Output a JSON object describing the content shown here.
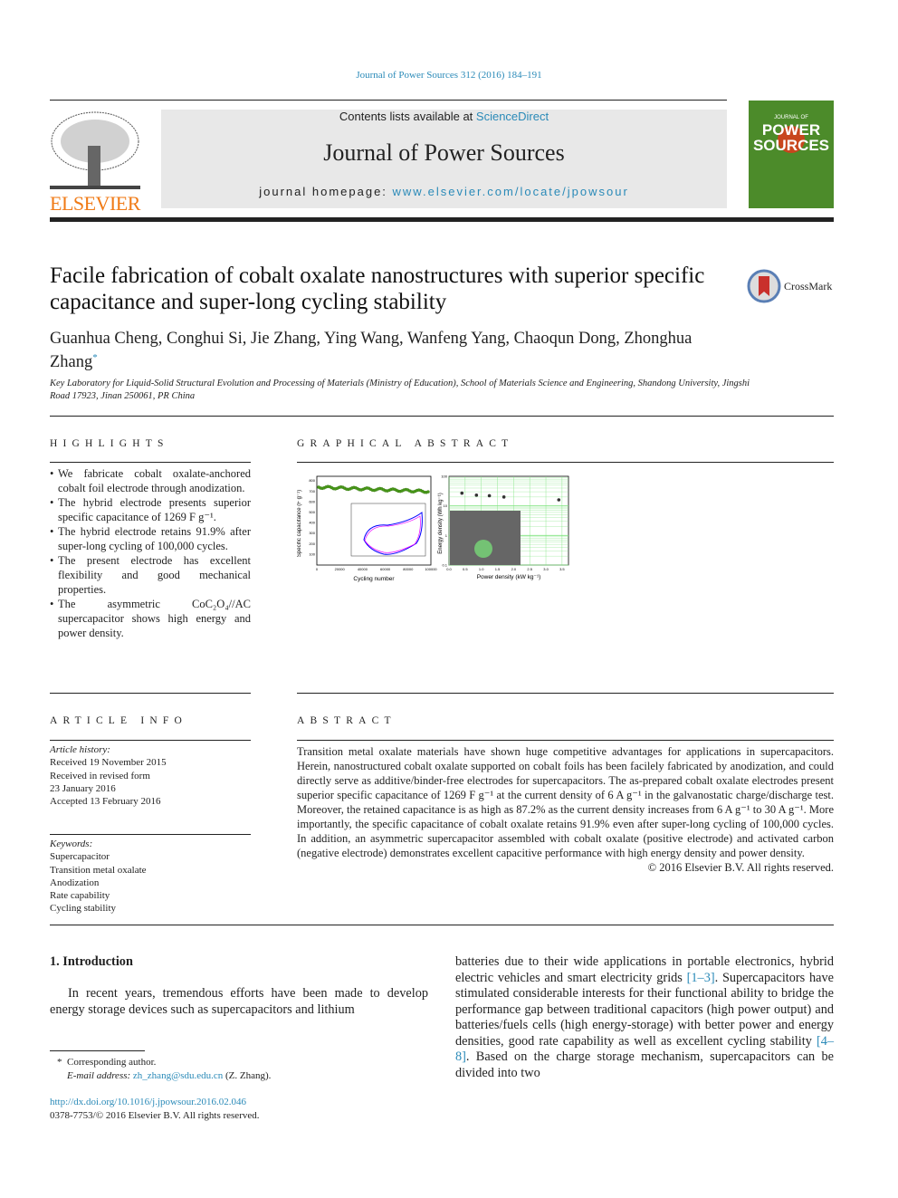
{
  "citation": "Journal of Power Sources 312 (2016) 184–191",
  "header": {
    "contents_prefix": "Contents lists available at ",
    "contents_link": "ScienceDirect",
    "journal_title": "Journal of Power Sources",
    "homepage_prefix": "journal homepage: ",
    "homepage_link": "www.elsevier.com/locate/jpowsour",
    "publisher": "ELSEVIER",
    "cover_text_top": "JOURNAL OF",
    "cover_text_main1": "POWER",
    "cover_text_main2": "SOURCES"
  },
  "crossmark": "CrossMark",
  "title": "Facile fabrication of cobalt oxalate nanostructures with superior specific capacitance and super-long cycling stability",
  "authors": "Guanhua Cheng, Conghui Si, Jie Zhang, Ying Wang, Wanfeng Yang, Chaoqun Dong, Zhonghua Zhang",
  "author_mark": "*",
  "affiliation": "Key Laboratory for Liquid-Solid Structural Evolution and Processing of Materials (Ministry of Education), School of Materials Science and Engineering, Shandong University, Jingshi Road 17923, Jinan 250061, PR China",
  "highlights": {
    "heading": "HIGHLIGHTS",
    "items": [
      "We fabricate cobalt oxalate-anchored cobalt foil electrode through anodization.",
      "The hybrid electrode presents superior specific capacitance of 1269 F g⁻¹.",
      "The hybrid electrode retains 91.9% after super-long cycling of 100,000 cycles.",
      "The present electrode has excellent flexibility and good mechanical properties.",
      "The asymmetric CoC₂O₄//AC supercapacitor shows high energy and power density."
    ]
  },
  "graphical_abstract": {
    "heading": "GRAPHICAL ABSTRACT",
    "left_chart": {
      "ylabel": "Specific capacitance (F g⁻¹)",
      "xlabel": "Cycling number",
      "xticks": [
        "0",
        "20000",
        "40000",
        "60000",
        "80000",
        "100000"
      ],
      "yticks": [
        "100",
        "200",
        "300",
        "400",
        "500",
        "600",
        "700",
        "800"
      ]
    },
    "right_chart": {
      "ylabel": "Energy density (Wh kg⁻¹)",
      "xlabel": "Power density (kW kg⁻¹)",
      "xticks": [
        "0.0",
        "0.5",
        "1.0",
        "1.5",
        "2.0",
        "2.5",
        "3.0",
        "3.5"
      ],
      "yticks": [
        "0.1",
        "1",
        "10",
        "100"
      ],
      "points": [
        [
          0.4,
          27
        ],
        [
          0.85,
          23
        ],
        [
          1.25,
          22
        ],
        [
          1.7,
          20
        ],
        [
          3.4,
          16
        ]
      ]
    }
  },
  "article_info": {
    "heading": "ARTICLE INFO",
    "history_label": "Article history:",
    "history": [
      "Received 19 November 2015",
      "Received in revised form",
      "23 January 2016",
      "Accepted 13 February 2016"
    ],
    "keywords_label": "Keywords:",
    "keywords": [
      "Supercapacitor",
      "Transition metal oxalate",
      "Anodization",
      "Rate capability",
      "Cycling stability"
    ]
  },
  "abstract": {
    "heading": "ABSTRACT",
    "text": "Transition metal oxalate materials have shown huge competitive advantages for applications in supercapacitors. Herein, nanostructured cobalt oxalate supported on cobalt foils has been facilely fabricated by anodization, and could directly serve as additive/binder-free electrodes for supercapacitors. The as-prepared cobalt oxalate electrodes present superior specific capacitance of 1269 F g⁻¹ at the current density of 6 A g⁻¹ in the galvanostatic charge/discharge test. Moreover, the retained capacitance is as high as 87.2% as the current density increases from 6 A g⁻¹ to 30 A g⁻¹. More importantly, the specific capacitance of cobalt oxalate retains 91.9% even after super-long cycling of 100,000 cycles. In addition, an asymmetric supercapacitor assembled with cobalt oxalate (positive electrode) and activated carbon (negative electrode) demonstrates excellent capacitive performance with high energy density and power density.",
    "copyright": "© 2016 Elsevier B.V. All rights reserved."
  },
  "intro": {
    "heading": "1.  Introduction",
    "para_left": "In recent years, tremendous efforts have been made to develop energy storage devices such as supercapacitors and lithium",
    "para_right_1": "batteries due to their wide applications in portable electronics, hybrid electric vehicles and smart electricity grids ",
    "ref1": "[1–3]",
    "para_right_2": ". Supercapacitors have stimulated considerable interests for their functional ability to bridge the performance gap between traditional capacitors (high power output) and batteries/fuels cells (high energy-storage) with better power and energy densities, good rate capability as well as excellent cycling stability ",
    "ref2": "[4–8]",
    "para_right_3": ". Based on the charge storage mechanism, supercapacitors can be divided into two"
  },
  "footnote": {
    "mark": "*",
    "text": "Corresponding author.",
    "email_label": "E-mail address: ",
    "email": "zh_zhang@sdu.edu.cn",
    "email_suffix": " (Z. Zhang)."
  },
  "doi": "http://dx.doi.org/10.1016/j.jpowsour.2016.02.046",
  "issn": "0378-7753/© 2016 Elsevier B.V. All rights reserved.",
  "colors": {
    "link": "#2a8ab8",
    "elsevier_orange": "#f07b17",
    "cover_green": "#4c8b2a",
    "header_gray": "#e8e8e8"
  }
}
